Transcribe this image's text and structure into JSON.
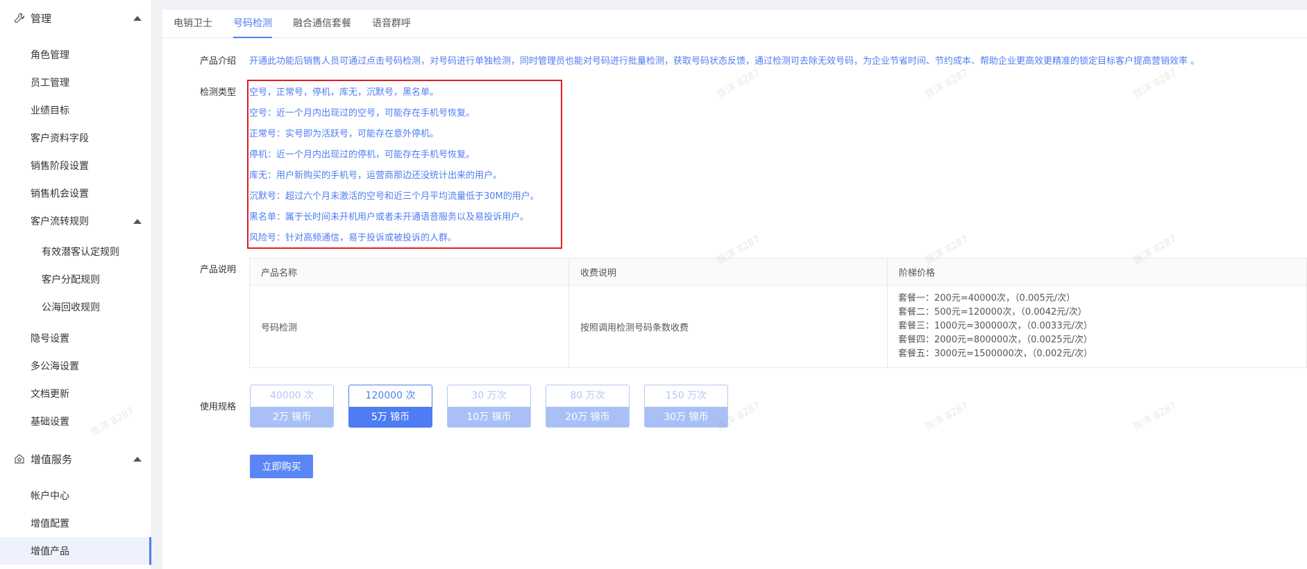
{
  "sidebar": {
    "group_manage": "管理",
    "manage_items": [
      "角色管理",
      "员工管理",
      "业绩目标",
      "客户资料字段",
      "销售阶段设置",
      "销售机会设置"
    ],
    "flow_rules": "客户流转规则",
    "flow_items": [
      "有效潜客认定规则",
      "客户分配规则",
      "公海回收规则"
    ],
    "manage_items2": [
      "隐号设置",
      "多公海设置",
      "文档更新",
      "基础设置"
    ],
    "group_value": "增值服务",
    "value_items": [
      "帐户中心",
      "增值配置",
      "增值产品"
    ]
  },
  "tabs": [
    "电销卫士",
    "号码检测",
    "融合通信套餐",
    "语音群呼"
  ],
  "labels": {
    "intro": "产品介绍",
    "types": "检测类型",
    "desc": "产品说明",
    "spec": "使用规格"
  },
  "intro_text": "开通此功能后销售人员可通过点击号码检测，对号码进行单独检测，同时管理员也能对号码进行批量检测，获取号码状态反馈，通过检测可去除无效号码，为企业节省时间、节约成本、帮助企业更高效更精准的锁定目标客户提高营销效率 。",
  "type_lines": [
    "空号，正常号，停机，库无，沉默号，黑名单。",
    "空号：近一个月内出现过的空号，可能存在手机号恢复。",
    "正常号：实号即为活跃号，可能存在意外停机。",
    "停机：近一个月内出现过的停机，可能存在手机号恢复。",
    "库无：用户新购买的手机号，运营商那边还没统计出来的用户。",
    "沉默号：超过六个月未激活的空号和近三个月平均流量低于30M的用户。",
    "黑名单：属于长时间未开机用户或者未开通语音服务以及易投诉用户。",
    "风险号：针对高频通信，易于投诉或被投诉的人群。"
  ],
  "table": {
    "headers": [
      "产品名称",
      "收费说明",
      "阶梯价格"
    ],
    "name": "号码检测",
    "fee": "按照调用检测号码条数收费",
    "prices": [
      "套餐一：200元=40000次，（0.005元/次）",
      "套餐二：500元=120000次，（0.0042元/次）",
      "套餐三：1000元=300000次，（0.0033元/次）",
      "套餐四：2000元=800000次，（0.0025元/次）",
      "套餐五：3000元=1500000次，（0.002元/次）"
    ]
  },
  "specs": [
    {
      "count": "40000 次",
      "price": "2万 锦币",
      "selected": false
    },
    {
      "count": "120000 次",
      "price": "5万 锦币",
      "selected": true
    },
    {
      "count": "30 万次",
      "price": "10万 锦币",
      "selected": false
    },
    {
      "count": "80 万次",
      "price": "20万 锦币",
      "selected": false
    },
    {
      "count": "150 万次",
      "price": "30万 锦币",
      "selected": false
    }
  ],
  "buy_label": "立即购买",
  "watermark": "陈洋 8287"
}
